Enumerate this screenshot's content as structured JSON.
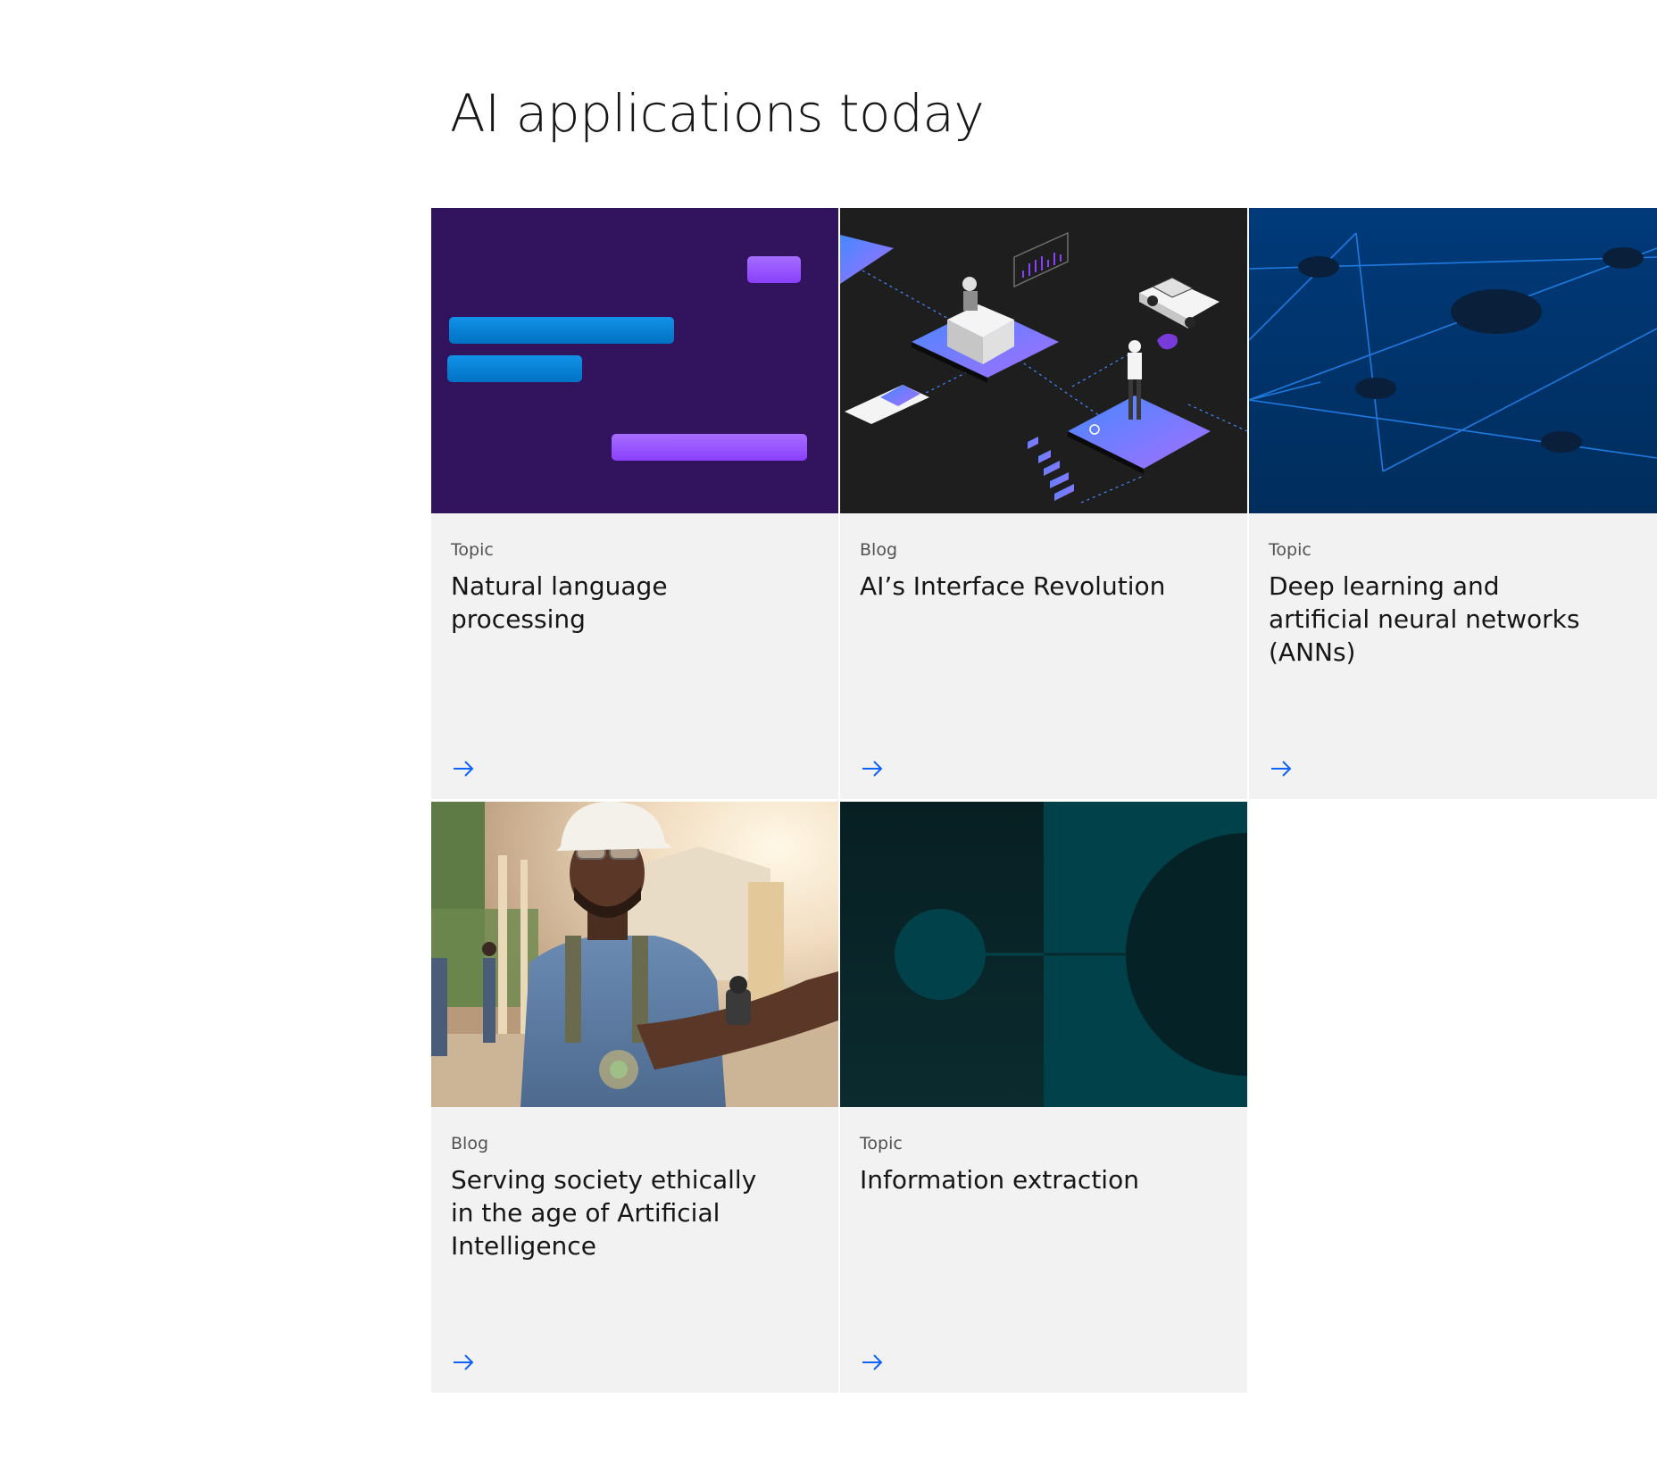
{
  "section": {
    "heading": "AI applications today"
  },
  "colors": {
    "card_background": "#f2f2f2",
    "arrow": "#0f62fe",
    "eyebrow": "#525252",
    "title": "#161616"
  },
  "cards": [
    {
      "eyebrow": "Topic",
      "title": "Natural language processing",
      "image_icon": "chat-bubbles-illustration",
      "link_icon": "arrow-right-icon"
    },
    {
      "eyebrow": "Blog",
      "title": "AI’s Interface Revolution",
      "image_icon": "isometric-ai-interface-illustration",
      "link_icon": "arrow-right-icon"
    },
    {
      "eyebrow": "Topic",
      "title": "Deep learning and artificial neural networks (ANNs)",
      "image_icon": "neural-network-illustration",
      "link_icon": "arrow-right-icon"
    },
    {
      "eyebrow": "Blog",
      "title": "Serving society ethically in the age of Artificial Intelligence",
      "image_icon": "construction-worker-photo",
      "link_icon": "arrow-right-icon"
    },
    {
      "eyebrow": "Topic",
      "title": "Information extraction",
      "image_icon": "circles-connection-illustration",
      "link_icon": "arrow-right-icon"
    }
  ]
}
